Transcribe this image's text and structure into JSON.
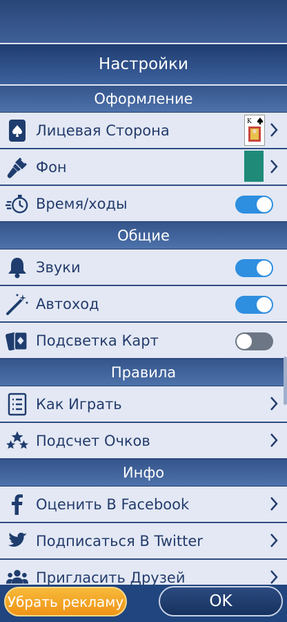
{
  "header": {
    "title": "Настройки"
  },
  "sections": [
    {
      "label": "Оформление"
    },
    {
      "label": "Общие"
    },
    {
      "label": "Правила"
    },
    {
      "label": "Инфо"
    }
  ],
  "rows": {
    "face": {
      "label": "Лицевая Сторона",
      "icon": "spade-card-icon",
      "card_rank": "K"
    },
    "background": {
      "label": "Фон",
      "icon": "paintbrush-icon",
      "color": "#1f8a78"
    },
    "time": {
      "label": "Время/ходы",
      "icon": "stopwatch-icon",
      "toggle": true
    },
    "sounds": {
      "label": "Звуки",
      "icon": "bell-icon",
      "toggle": true
    },
    "automove": {
      "label": "Автоход",
      "icon": "magic-wand-icon",
      "toggle": true
    },
    "highlight": {
      "label": "Подсветка Карт",
      "icon": "cards-icon",
      "toggle": false
    },
    "howto": {
      "label": "Как Играть",
      "icon": "list-icon"
    },
    "scoring": {
      "label": "Подсчет Очков",
      "icon": "stars-icon"
    },
    "facebook": {
      "label": "Оценить В Facebook",
      "icon": "facebook-icon"
    },
    "twitter": {
      "label": "Подписаться В Twitter",
      "icon": "twitter-icon"
    },
    "invite": {
      "label": "Пригласить Друзей",
      "icon": "people-icon"
    }
  },
  "footer": {
    "remove_ads": "Убрать рекламу",
    "ok": "OK"
  },
  "colors": {
    "accent": "#2e8ee0",
    "toggle_off": "#6c7684",
    "text": "#243c6c",
    "ads_button": "#f4a323"
  }
}
